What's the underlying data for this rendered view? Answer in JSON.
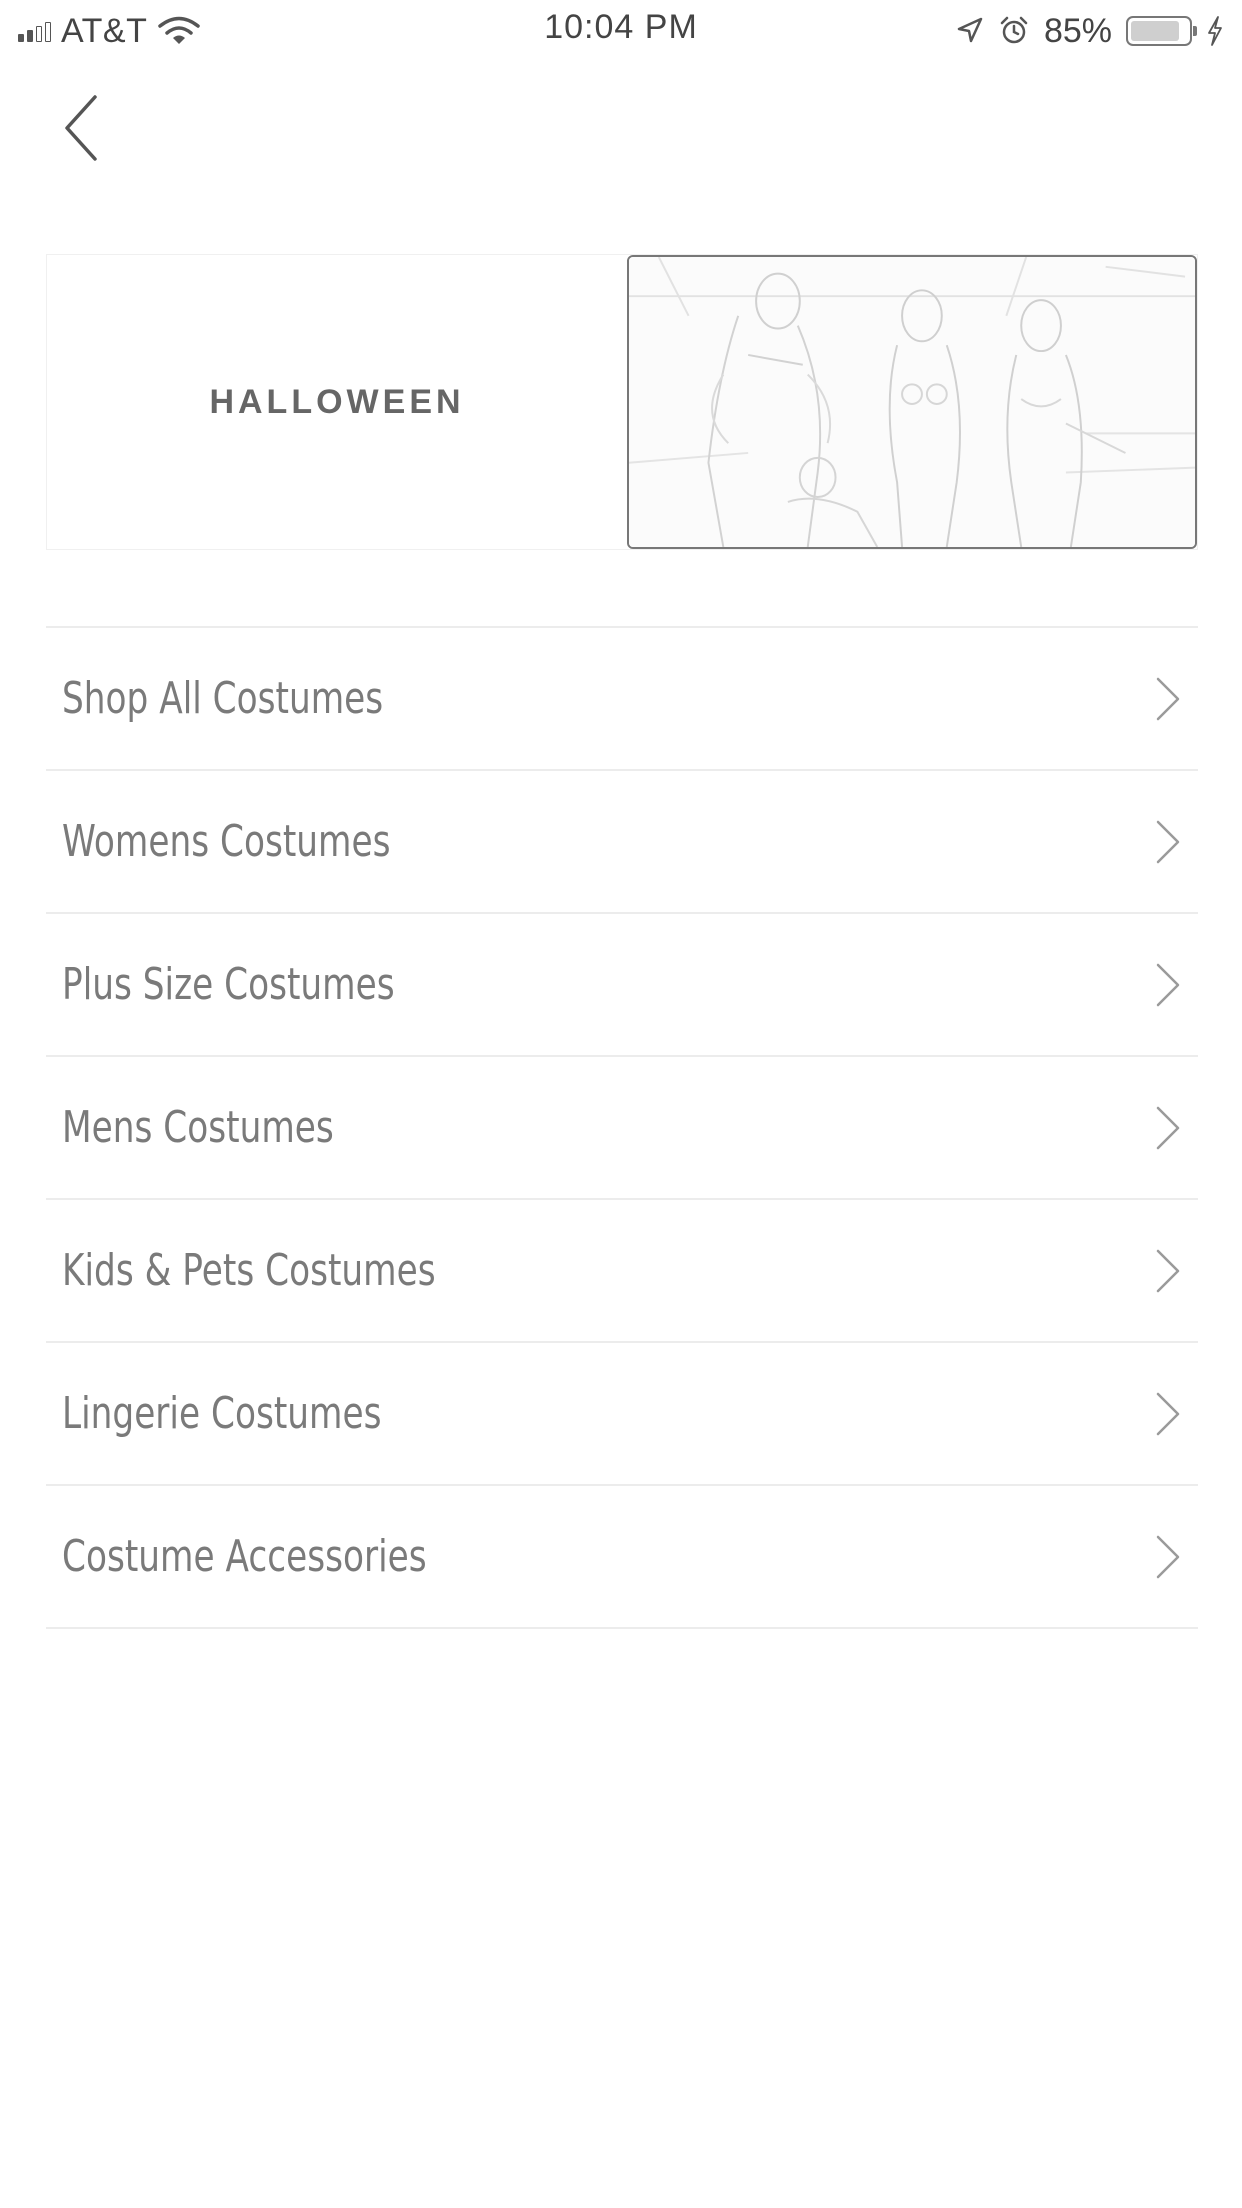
{
  "status_bar": {
    "carrier": "AT&T",
    "time": "10:04 PM",
    "battery_percent": "85%",
    "battery_level": 0.85,
    "signal_bars_filled": 2,
    "signal_bars_total": 5,
    "icons": [
      "signal-icon",
      "wifi-icon",
      "location-arrow-icon",
      "alarm-icon",
      "battery-icon",
      "charging-bolt-icon"
    ]
  },
  "header": {
    "back_icon": "chevron-left-icon"
  },
  "banner": {
    "title": "HALLOWEEN",
    "image": "costume-models-photo"
  },
  "menu": {
    "items": [
      {
        "label": "Shop All Costumes"
      },
      {
        "label": "Womens Costumes"
      },
      {
        "label": "Plus Size Costumes"
      },
      {
        "label": "Mens Costumes"
      },
      {
        "label": "Kids & Pets Costumes"
      },
      {
        "label": "Lingerie Costumes"
      },
      {
        "label": "Costume Accessories"
      }
    ],
    "item_icon": "chevron-right-icon"
  },
  "colors": {
    "text": "#7a7a7a",
    "divider": "#ececec",
    "background": "#ffffff"
  }
}
